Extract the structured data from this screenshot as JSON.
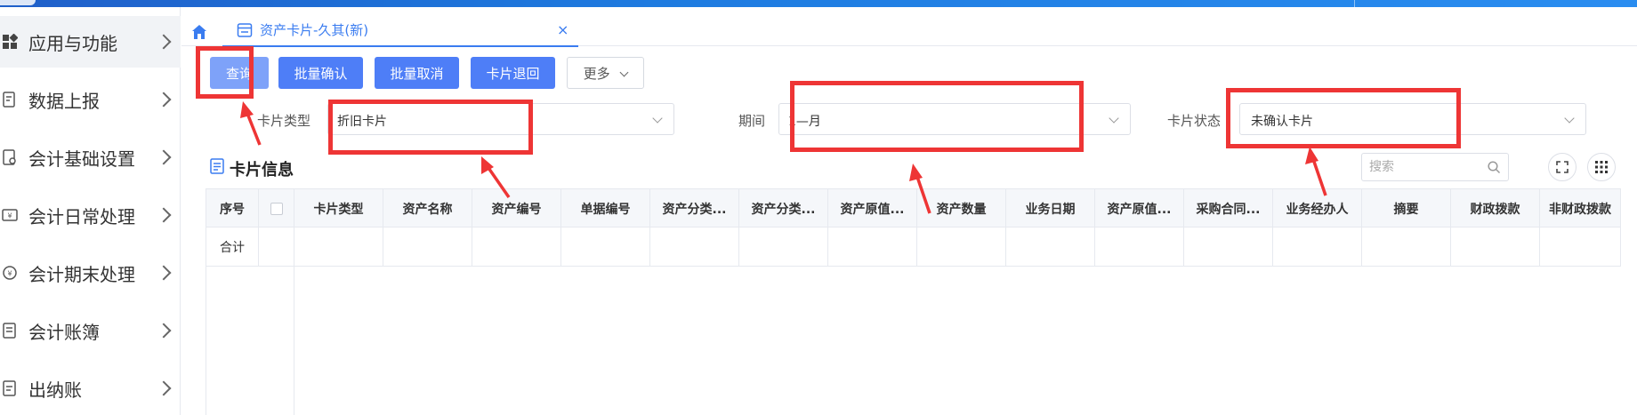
{
  "sidebar": {
    "items": [
      {
        "label": "应用与功能",
        "icon": "grid-icon",
        "active": true
      },
      {
        "label": "数据上报",
        "icon": "report-icon"
      },
      {
        "label": "会计基础设置",
        "icon": "settings-doc-icon"
      },
      {
        "label": "会计日常处理",
        "icon": "daily-icon"
      },
      {
        "label": "会计期末处理",
        "icon": "period-end-icon"
      },
      {
        "label": "会计账簿",
        "icon": "ledger-icon"
      },
      {
        "label": "出纳账",
        "icon": "cashier-icon"
      }
    ]
  },
  "tabs": {
    "home_icon": "home-icon",
    "active_tab": {
      "label": "资产卡片-久其(新)",
      "icon": "card-icon",
      "close": "×"
    }
  },
  "toolbar": {
    "query": "查询",
    "batch_confirm": "批量确认",
    "batch_cancel": "批量取消",
    "card_return": "卡片退回",
    "more": "更多"
  },
  "filters": {
    "card_type": {
      "label": "卡片类型",
      "value": "折旧卡片"
    },
    "period": {
      "label": "期间",
      "value": "1—月"
    },
    "card_status": {
      "label": "卡片状态",
      "value": "未确认卡片"
    }
  },
  "section": {
    "title": "卡片信息",
    "search_placeholder": "搜索"
  },
  "table": {
    "columns": [
      "序号",
      "",
      "卡片类型",
      "资产名称",
      "资产编号",
      "单据编号",
      "资产分类...",
      "资产分类...",
      "资产原值...",
      "资产数量",
      "业务日期",
      "资产原值...",
      "采购合同...",
      "业务经办人",
      "摘要",
      "财政拨款",
      "非财政拨款"
    ],
    "summary_row": {
      "label": "合计"
    }
  },
  "colors": {
    "primary": "#4e7ef7",
    "annotation": "#ee3535"
  }
}
